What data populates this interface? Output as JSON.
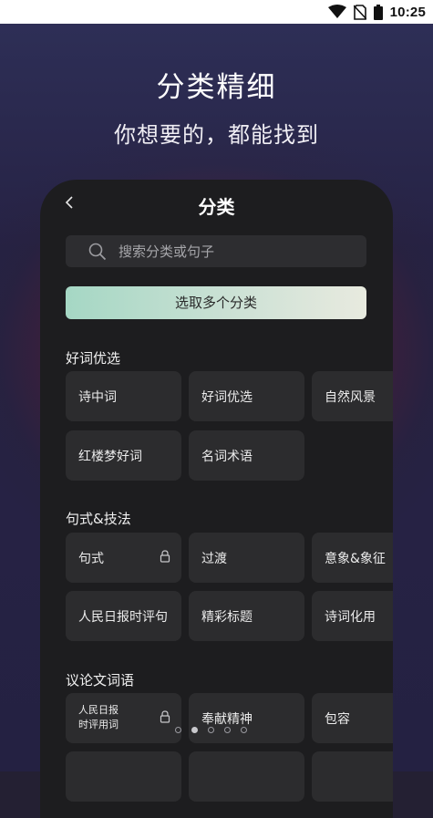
{
  "status_bar": {
    "time": "10:25"
  },
  "promo": {
    "headline": "分类精细",
    "subheadline": "你想要的，都能找到"
  },
  "screen": {
    "title": "分类",
    "search_placeholder": "搜索分类或句子",
    "multi_select_label": "选取多个分类",
    "sections": [
      {
        "title": "好词优选",
        "items": [
          {
            "label": "诗中词"
          },
          {
            "label": "好词优选"
          },
          {
            "label": "自然风景"
          },
          {
            "label": "红楼梦好词"
          },
          {
            "label": "名词术语"
          }
        ]
      },
      {
        "title": "句式&技法",
        "items": [
          {
            "label": "句式",
            "locked": true
          },
          {
            "label": "过渡"
          },
          {
            "label": "意象&象征"
          },
          {
            "label": "人民日报时评句"
          },
          {
            "label": "精彩标题"
          },
          {
            "label": "诗词化用"
          }
        ]
      },
      {
        "title": "议论文词语",
        "items": [
          {
            "label": "人民日报\n时评用词",
            "locked": true
          },
          {
            "label": "奉献精神"
          },
          {
            "label": "包容"
          }
        ]
      }
    ]
  },
  "pager": {
    "count": 5,
    "active_index": 1
  },
  "colors": {
    "accent_start": "#a5d7c4",
    "accent_end": "#e8eadf",
    "chip_bg": "#2c2c2e"
  }
}
